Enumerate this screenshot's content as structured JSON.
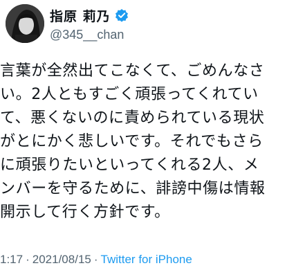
{
  "user": {
    "display_name": "指原 莉乃",
    "handle": "@345__chan",
    "verified": true,
    "verified_icon": "verified-badge-icon",
    "avatar_icon": "profile-avatar"
  },
  "tweet": {
    "lines": [
      "言葉が全然出てこなくて、ごめんなさ",
      "い。2人ともすごく頑張ってくれてい",
      "て、悪くないのに責められている現状",
      "がとにかく悲しいです。それでもさら",
      "に頑張りたいといってくれる2人、メ",
      "ンバーを守るために、誹謗中傷は情報",
      "開示して行く方針です。"
    ],
    "time": "1:17",
    "separator": "·",
    "date": "2021/08/15",
    "source": "Twitter for iPhone"
  },
  "colors": {
    "text": "#0f1419",
    "secondary": "#536471",
    "accent": "#1d9bf0"
  }
}
